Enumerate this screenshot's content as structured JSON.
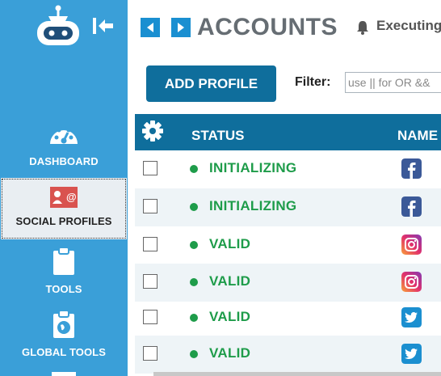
{
  "colors": {
    "sidebar": "#3a9fd8",
    "header": "#0f6e9c",
    "status_valid": "#1e9c4a",
    "title": "#666d73"
  },
  "sidebar": {
    "items": [
      {
        "label": "DASHBOARD",
        "icon": "dashboard-icon"
      },
      {
        "label": "SOCIAL PROFILES",
        "icon": "social-profiles-icon",
        "active": true
      },
      {
        "label": "TOOLS",
        "icon": "clipboard-icon"
      },
      {
        "label": "GLOBAL TOOLS",
        "icon": "globe-clipboard-icon"
      }
    ]
  },
  "header": {
    "title": "ACCOUNTS",
    "status_text": "Executing"
  },
  "toolbar": {
    "add_profile_label": "ADD PROFILE",
    "filter_label": "Filter:",
    "filter_placeholder": "use || for OR &&"
  },
  "table": {
    "columns": [
      "STATUS",
      "NAME"
    ],
    "rows": [
      {
        "status": "INITIALIZING",
        "network": "facebook-icon"
      },
      {
        "status": "INITIALIZING",
        "network": "facebook-icon"
      },
      {
        "status": "VALID",
        "network": "instagram-icon"
      },
      {
        "status": "VALID",
        "network": "instagram-icon"
      },
      {
        "status": "VALID",
        "network": "twitter-icon"
      },
      {
        "status": "VALID",
        "network": "twitter-icon"
      }
    ]
  }
}
